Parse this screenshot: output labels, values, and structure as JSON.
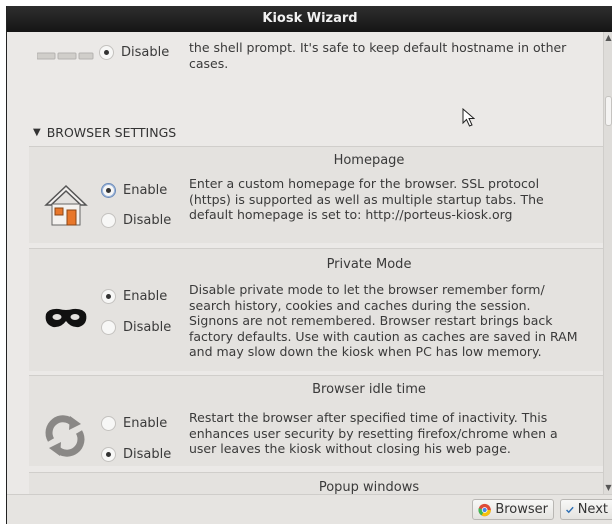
{
  "window": {
    "title": "Kiosk Wizard"
  },
  "top_section": {
    "option_disable": "Disable",
    "desc_line1": "the shell prompt. It's safe to keep default hostname in other",
    "desc_line2": "cases."
  },
  "group": {
    "label": "BROWSER SETTINGS"
  },
  "sections": [
    {
      "title": "Homepage",
      "icon": "house-icon",
      "options": [
        {
          "label": "Enable",
          "selected": true,
          "focused": true
        },
        {
          "label": "Disable",
          "selected": false
        }
      ],
      "desc": [
        "Enter a custom homepage for the browser. SSL protocol",
        "(https) is supported as well as multiple startup tabs. The",
        "default homepage is set to: http://porteus-kiosk.org"
      ]
    },
    {
      "title": "Private Mode",
      "icon": "mask-icon",
      "options": [
        {
          "label": "Enable",
          "selected": true
        },
        {
          "label": "Disable",
          "selected": false
        }
      ],
      "desc": [
        "Disable private mode to let the browser remember form/",
        "search history, cookies and caches during the session.",
        "Signons are not remembered. Browser restart brings back",
        "factory defaults. Use with caution as caches are saved in RAM",
        "and may slow down the kiosk when PC has low memory."
      ]
    },
    {
      "title": "Browser idle time",
      "icon": "refresh-icon",
      "options": [
        {
          "label": "Enable",
          "selected": false
        },
        {
          "label": "Disable",
          "selected": true
        }
      ],
      "desc": [
        "Restart the browser after specified time of inactivity. This",
        "enhances user security by resetting firefox/chrome when a",
        "user leaves the kiosk without closing his web page."
      ]
    },
    {
      "title": "Popup windows"
    }
  ],
  "buttons": {
    "browser": "Browser",
    "next": "Next"
  },
  "colors": {
    "titlebar": "#1b1b1b",
    "section_bg": "#e4e2df",
    "window_bg": "#e8e6e4"
  }
}
